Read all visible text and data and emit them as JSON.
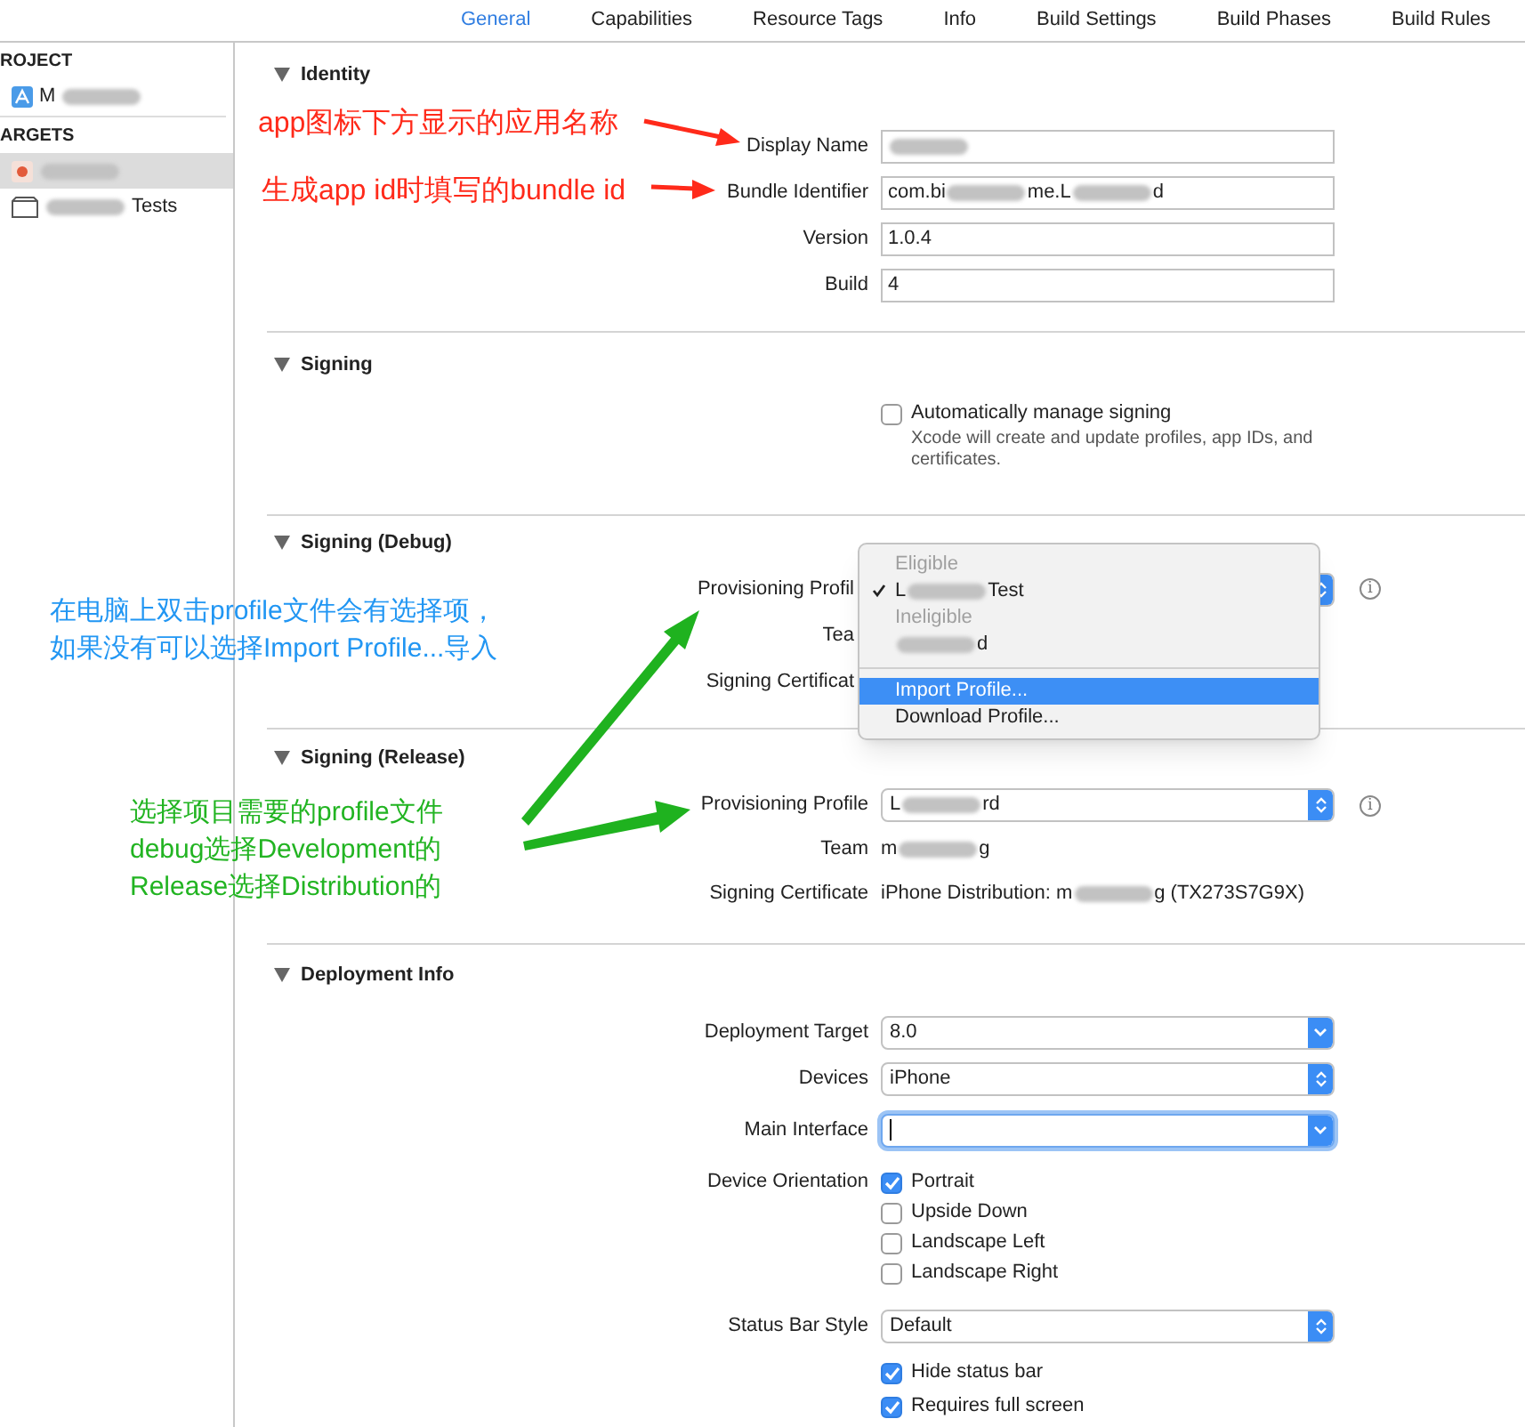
{
  "tabs": [
    {
      "label": "General",
      "selected": true
    },
    {
      "label": "Capabilities",
      "selected": false
    },
    {
      "label": "Resource Tags",
      "selected": false
    },
    {
      "label": "Info",
      "selected": false
    },
    {
      "label": "Build Settings",
      "selected": false
    },
    {
      "label": "Build Phases",
      "selected": false
    },
    {
      "label": "Build Rules",
      "selected": false
    }
  ],
  "sidebar": {
    "groups": [
      {
        "heading": "ROJECT",
        "items": [
          {
            "kind": "app",
            "parts": [
              {
                "text": "M"
              },
              {
                "kind": "blur"
              }
            ],
            "selected": false
          }
        ]
      },
      {
        "heading": "ARGETS",
        "items": [
          {
            "kind": "target",
            "parts": [
              {
                "kind": "blur"
              }
            ],
            "selected": true
          },
          {
            "kind": "test_bundle",
            "parts": [
              {
                "kind": "blur"
              },
              {
                "text": "Tests"
              }
            ],
            "selected": false
          }
        ]
      }
    ]
  },
  "sections": [
    {
      "title": "Identity",
      "rows": [
        {
          "kind": "field",
          "label": "Display Name",
          "parts": [
            {
              "kind": "blur"
            }
          ]
        },
        {
          "kind": "field",
          "label": "Bundle Identifier",
          "parts": [
            {
              "text": "com.bi"
            },
            {
              "kind": "blur"
            },
            {
              "text": "me.L"
            },
            {
              "kind": "blur"
            },
            {
              "text": "d"
            }
          ]
        },
        {
          "kind": "field",
          "label": "Version",
          "parts": [
            {
              "text": "1.0.4"
            }
          ]
        },
        {
          "kind": "field",
          "label": "Build",
          "parts": [
            {
              "text": "4"
            }
          ]
        }
      ]
    },
    {
      "title": "Signing",
      "rows": [
        {
          "kind": "checkbox",
          "text": "Automatically manage signing",
          "checked": false,
          "note": "Xcode will create and update profiles, app IDs, and certificates."
        }
      ]
    },
    {
      "title": "Signing (Debug)",
      "rows": [
        {
          "kind": "popup",
          "label": "Provisioning Profil",
          "info": "i"
        },
        {
          "kind": "text",
          "label": "Tea"
        },
        {
          "kind": "text",
          "label": "Signing Certificat"
        }
      ]
    },
    {
      "title": "Signing (Release)",
      "rows": [
        {
          "kind": "popup",
          "label": "Provisioning Profile",
          "info": "i",
          "parts": [
            {
              "text": "L"
            },
            {
              "kind": "blur"
            },
            {
              "text": "rd"
            }
          ]
        },
        {
          "kind": "text",
          "label": "Team",
          "parts": [
            {
              "text": "m"
            },
            {
              "kind": "blur"
            },
            {
              "text": "g"
            }
          ]
        },
        {
          "kind": "text",
          "label": "Signing Certificate",
          "parts": [
            {
              "text": "iPhone Distribution: m"
            },
            {
              "kind": "blur"
            },
            {
              "text": "g (TX273S7G9X)"
            }
          ]
        }
      ]
    },
    {
      "title": "Deployment Info",
      "rows": [
        {
          "kind": "combo",
          "label": "Deployment Target",
          "parts": [
            {
              "text": "8.0"
            }
          ]
        },
        {
          "kind": "popup",
          "label": "Devices",
          "parts": [
            {
              "text": "iPhone"
            }
          ]
        },
        {
          "kind": "combo",
          "label": "Main Interface",
          "focused": true
        },
        {
          "kind": "checkbox",
          "label": "Device Orientation",
          "text": "Portrait",
          "checked": true
        },
        {
          "kind": "checkbox",
          "text": "Upside Down",
          "checked": false
        },
        {
          "kind": "checkbox",
          "text": "Landscape Left",
          "checked": false
        },
        {
          "kind": "checkbox",
          "text": "Landscape Right",
          "checked": false
        },
        {
          "kind": "popup",
          "label": "Status Bar Style",
          "parts": [
            {
              "text": "Default"
            }
          ]
        },
        {
          "kind": "checkbox",
          "text": "Hide status bar",
          "checked": true
        },
        {
          "kind": "checkbox",
          "text": "Requires full screen",
          "checked": true
        }
      ]
    }
  ],
  "menu": {
    "items": [
      {
        "kind": "header",
        "text": "Eligible"
      },
      {
        "kind": "item",
        "parts": [
          {
            "text": "L"
          },
          {
            "kind": "blur"
          },
          {
            "text": "Test"
          }
        ],
        "checked": true,
        "selected": false
      },
      {
        "kind": "header",
        "text": "Ineligible"
      },
      {
        "kind": "item",
        "parts": [
          {
            "kind": "blur"
          },
          {
            "text": "d"
          }
        ],
        "checked": false,
        "selected": false
      },
      {
        "kind": "separator"
      },
      {
        "kind": "item",
        "parts": [
          {
            "text": "Import Profile..."
          }
        ],
        "checked": false,
        "selected": true
      },
      {
        "kind": "item",
        "parts": [
          {
            "text": "Download Profile..."
          }
        ],
        "checked": false,
        "selected": false
      }
    ]
  },
  "annotations": [
    {
      "lines": [
        "app图标下方显示的应用名称"
      ],
      "color": "#ff2a1a"
    },
    {
      "lines": [
        "生成app id时填写的bundle id"
      ],
      "color": "#ff2a1a"
    },
    {
      "lines": [
        "在电脑上双击profile文件会有选择项，",
        "如果没有可以选择Import Profile...导入"
      ],
      "color": "#2196f3"
    },
    {
      "lines": [
        "选择项目需要的profile文件",
        "debug选择Development的",
        "Release选择Distribution的"
      ],
      "color": "#22b422"
    }
  ]
}
